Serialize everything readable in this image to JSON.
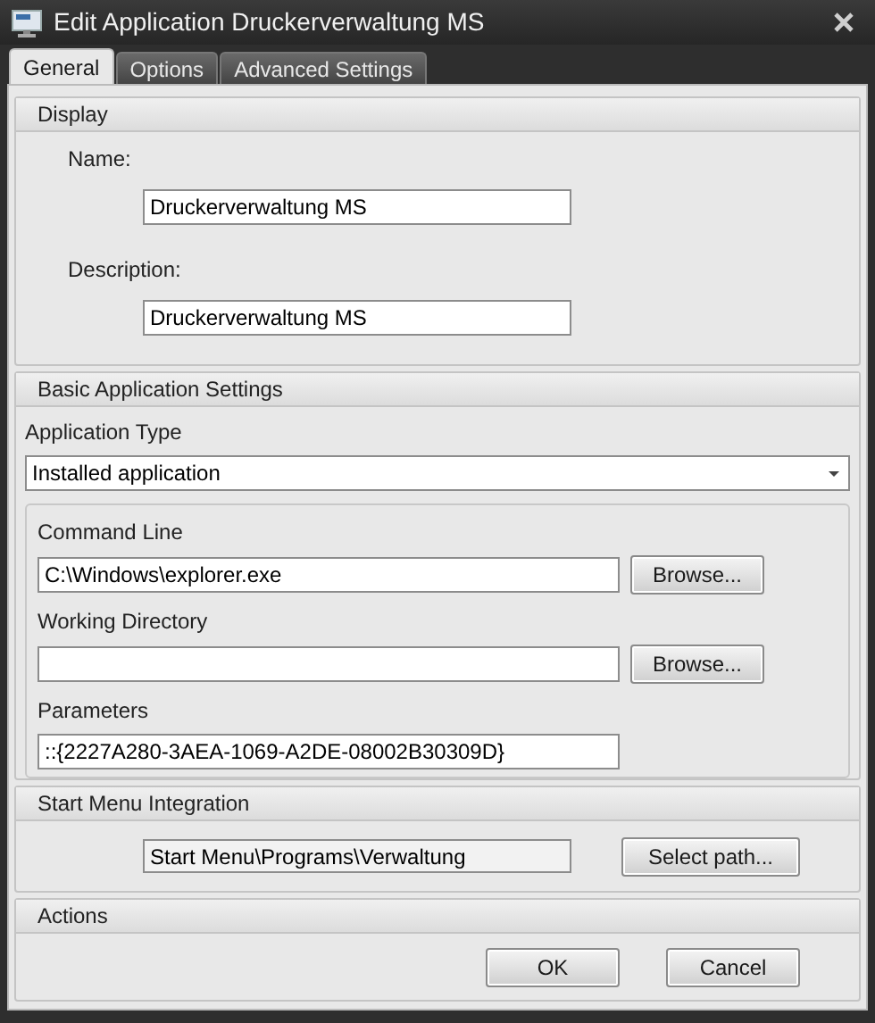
{
  "window": {
    "title": "Edit Application Druckerverwaltung MS"
  },
  "tabs": [
    {
      "label": "General",
      "selected": true
    },
    {
      "label": "Options",
      "selected": false
    },
    {
      "label": "Advanced Settings",
      "selected": false
    }
  ],
  "display": {
    "heading": "Display",
    "name_label": "Name:",
    "name_value": "Druckerverwaltung MS",
    "description_label": "Description:",
    "description_value": "Druckerverwaltung MS"
  },
  "basic": {
    "heading": "Basic Application Settings",
    "type_label": "Application Type",
    "type_value": "Installed application",
    "command_label": "Command Line",
    "command_value": "C:\\Windows\\explorer.exe",
    "command_button": "Browse...",
    "workdir_label": "Working Directory",
    "workdir_button": "Browse...",
    "params_label": "Parameters",
    "params_value": "::{2227A280-3AEA-1069-A2DE-08002B30309D}"
  },
  "start_menu": {
    "heading": "Start Menu Integration",
    "path_value": "Start Menu\\Programs\\Verwaltung",
    "button": "Select path..."
  },
  "actions": {
    "heading": "Actions",
    "buttons": [
      "OK",
      "Cancel"
    ]
  }
}
